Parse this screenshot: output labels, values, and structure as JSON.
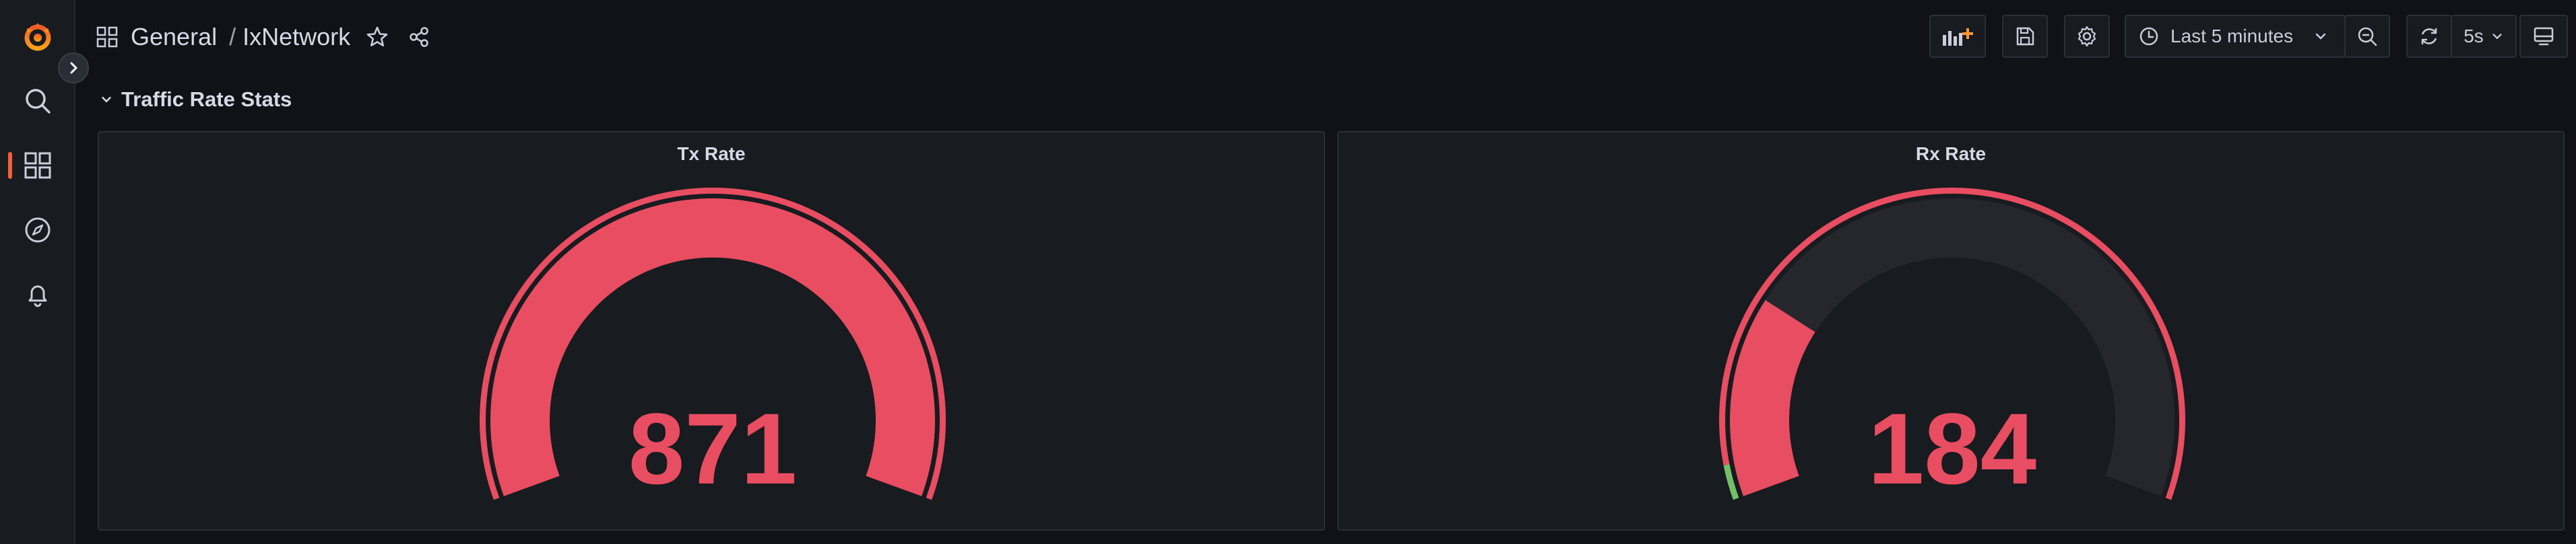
{
  "breadcrumb": {
    "folder": "General",
    "separator": "/",
    "dashboard": "IxNetwork"
  },
  "toolbar": {
    "time_range": "Last 5 minutes",
    "refresh_interval": "5s"
  },
  "row": {
    "title": "Traffic Rate Stats"
  },
  "panels": [
    {
      "title": "Tx Rate",
      "value": "871",
      "fraction": 1.0,
      "threshold_green_fraction": 0.0
    },
    {
      "title": "Rx Rate",
      "value": "184",
      "fraction": 0.24,
      "threshold_green_fraction": 0.04
    }
  ],
  "colors": {
    "gauge_red": "#e84d61",
    "gauge_track": "#25272d",
    "gauge_green": "#73bf69",
    "brand_orange": "#f55f3e",
    "background": "#111217",
    "panel": "#181b1f"
  },
  "icons": {
    "logo": "grafana-logo",
    "search": "search-icon",
    "dashboards": "dashboards-grid-icon",
    "explore": "compass-icon",
    "alerting": "bell-icon",
    "add_panel": "add-panel-icon",
    "save": "save-icon",
    "settings": "gear-icon",
    "time": "clock-icon",
    "zoom_out": "zoom-out-icon",
    "refresh": "refresh-icon",
    "tv": "tv-mode-icon",
    "star": "star-icon",
    "share": "share-icon"
  }
}
